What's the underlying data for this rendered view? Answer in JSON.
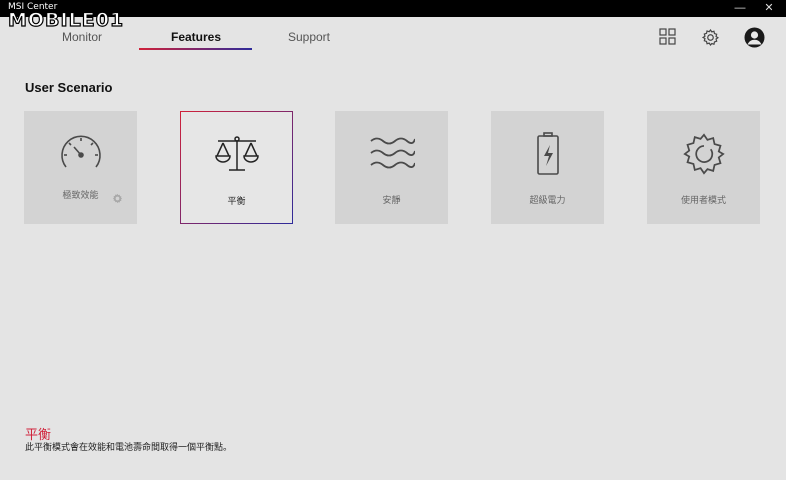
{
  "window": {
    "title": "MSI Center",
    "watermark": "MOBILE01",
    "minimize_glyph": "—",
    "close_glyph": "✕"
  },
  "nav": {
    "tabs": [
      {
        "label": "Monitor",
        "active": false
      },
      {
        "label": "Features",
        "active": true
      },
      {
        "label": "Support",
        "active": false
      }
    ],
    "icons": [
      "grid-icon",
      "settings-icon",
      "user-avatar"
    ]
  },
  "section": {
    "title": "User Scenario"
  },
  "scenarios": [
    {
      "label": "極致效能",
      "icon": "speedometer-icon",
      "active": false,
      "has_settings": true
    },
    {
      "label": "平衡",
      "icon": "balance-scale-icon",
      "active": true,
      "has_settings": false
    },
    {
      "label": "安靜",
      "icon": "waves-icon",
      "active": false,
      "has_settings": false
    },
    {
      "label": "超級電力",
      "icon": "battery-icon",
      "active": false,
      "has_settings": false
    },
    {
      "label": "使用者模式",
      "icon": "gear-icon",
      "active": false,
      "has_settings": false
    }
  ],
  "description": {
    "title": "平衡",
    "text": "此平衡模式會在效能和電池壽命間取得一個平衡點。"
  },
  "colors": {
    "accent_red": "#d0213a",
    "accent_blue": "#2e2b9a",
    "background": "#e4e4e4",
    "card": "#d3d3d3"
  }
}
